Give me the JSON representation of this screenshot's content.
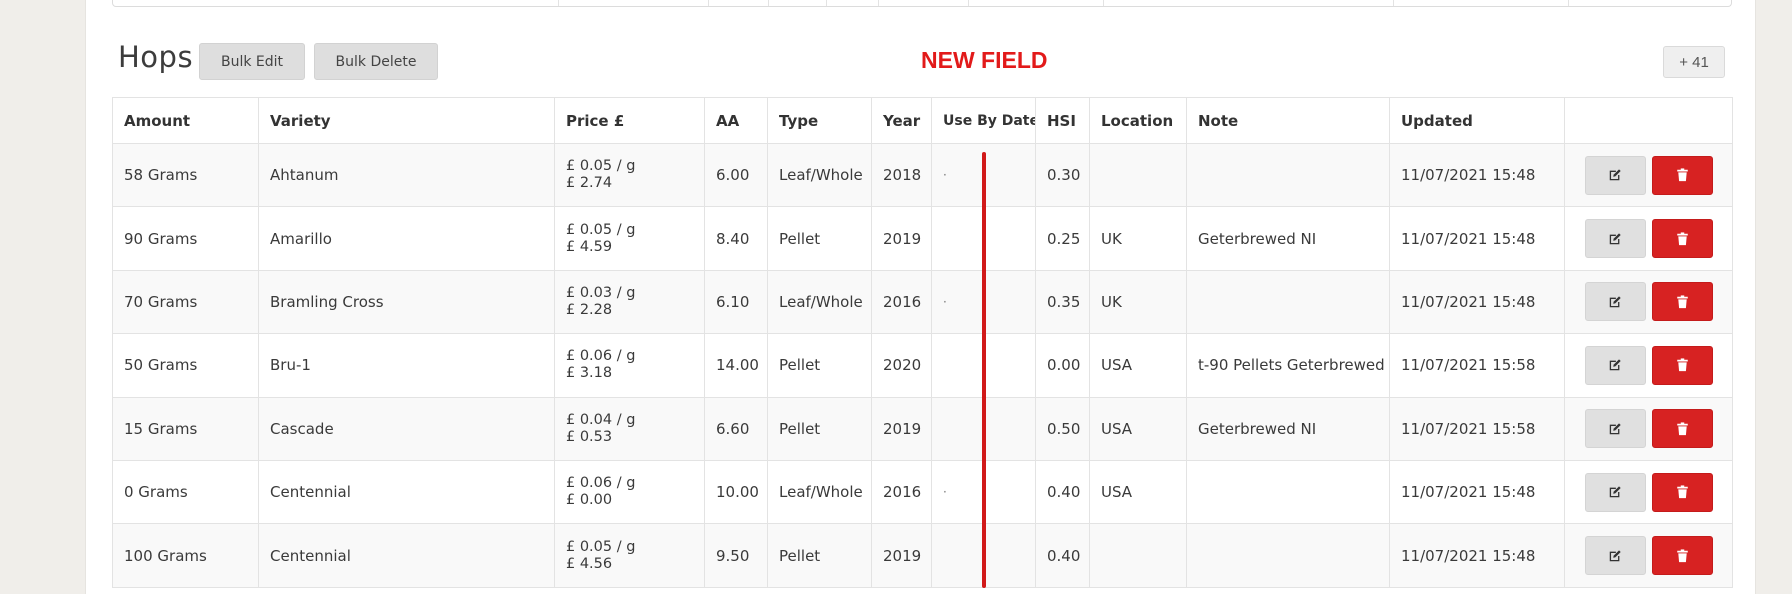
{
  "section": {
    "title": "Hops",
    "bulk_edit_label": "Bulk Edit",
    "bulk_delete_label": "Bulk Delete",
    "annotation": "NEW FIELD",
    "add_button_label": "+ 41"
  },
  "table": {
    "headers": [
      "Amount",
      "Variety",
      "Price £",
      "AA",
      "Type",
      "Year",
      "Use By Date",
      "HSI",
      "Location",
      "Note",
      "Updated",
      ""
    ],
    "rows": [
      {
        "amount": "58 Grams",
        "variety": "Ahtanum",
        "price_per": "£ 0.05 / g",
        "price_total": "£ 2.74",
        "aa": "6.00",
        "type": "Leaf/Whole",
        "year": "2018",
        "use_by": "·",
        "hsi": "0.30",
        "location": "",
        "note": "",
        "updated": "11/07/2021 15:48"
      },
      {
        "amount": "90 Grams",
        "variety": "Amarillo",
        "price_per": "£ 0.05 / g",
        "price_total": "£ 4.59",
        "aa": "8.40",
        "type": "Pellet",
        "year": "2019",
        "use_by": "",
        "hsi": "0.25",
        "location": "UK",
        "note": "Geterbrewed NI",
        "updated": "11/07/2021 15:48"
      },
      {
        "amount": "70 Grams",
        "variety": "Bramling Cross",
        "price_per": "£ 0.03 / g",
        "price_total": "£ 2.28",
        "aa": "6.10",
        "type": "Leaf/Whole",
        "year": "2016",
        "use_by": "·",
        "hsi": "0.35",
        "location": "UK",
        "note": "",
        "updated": "11/07/2021 15:48"
      },
      {
        "amount": "50 Grams",
        "variety": "Bru-1",
        "price_per": "£ 0.06 / g",
        "price_total": "£ 3.18",
        "aa": "14.00",
        "type": "Pellet",
        "year": "2020",
        "use_by": "",
        "hsi": "0.00",
        "location": "USA",
        "note": "t-90 Pellets Geterbrewed",
        "updated": "11/07/2021 15:58"
      },
      {
        "amount": "15 Grams",
        "variety": "Cascade",
        "price_per": "£ 0.04 / g",
        "price_total": "£ 0.53",
        "aa": "6.60",
        "type": "Pellet",
        "year": "2019",
        "use_by": "",
        "hsi": "0.50",
        "location": "USA",
        "note": "Geterbrewed NI",
        "updated": "11/07/2021 15:58"
      },
      {
        "amount": "0 Grams",
        "variety": "Centennial",
        "price_per": "£ 0.06 / g",
        "price_total": "£ 0.00",
        "aa": "10.00",
        "type": "Leaf/Whole",
        "year": "2016",
        "use_by": "·",
        "hsi": "0.40",
        "location": "USA",
        "note": "",
        "updated": "11/07/2021 15:48"
      },
      {
        "amount": "100 Grams",
        "variety": "Centennial",
        "price_per": "£ 0.05 / g",
        "price_total": "£ 4.56",
        "aa": "9.50",
        "type": "Pellet",
        "year": "2019",
        "use_by": "",
        "hsi": "0.40",
        "location": "",
        "note": "",
        "updated": "11/07/2021 15:48"
      }
    ]
  },
  "icons": {
    "edit": "edit-icon",
    "delete": "trash-icon"
  },
  "colors": {
    "accent_red": "#d72222",
    "annotation_red": "#e21a1a",
    "button_grey": "#e0e0e0"
  }
}
